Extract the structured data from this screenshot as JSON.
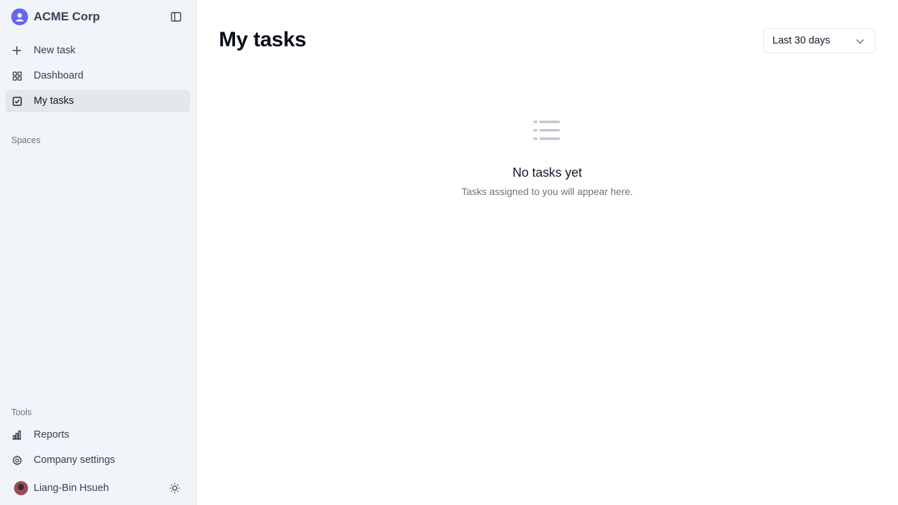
{
  "sidebar": {
    "brand": {
      "name": "ACME Corp",
      "logo_icon": "user-circle-icon",
      "accent": "#6366f1"
    },
    "nav": [
      {
        "label": "New task",
        "icon": "plus-icon",
        "active": false
      },
      {
        "label": "Dashboard",
        "icon": "grid-icon",
        "active": false
      },
      {
        "label": "My tasks",
        "icon": "checkbox-icon",
        "active": true
      }
    ],
    "spaces_label": "Spaces",
    "tools_label": "Tools",
    "tools": [
      {
        "label": "Reports",
        "icon": "bar-chart-icon"
      },
      {
        "label": "Company settings",
        "icon": "gear-icon"
      }
    ],
    "user": {
      "name": "Liang-Bin Hsueh"
    }
  },
  "main": {
    "title": "My tasks",
    "range": {
      "value": "Last 30 days"
    },
    "empty": {
      "title": "No tasks yet",
      "subtitle": "Tasks assigned to you will appear here."
    }
  }
}
